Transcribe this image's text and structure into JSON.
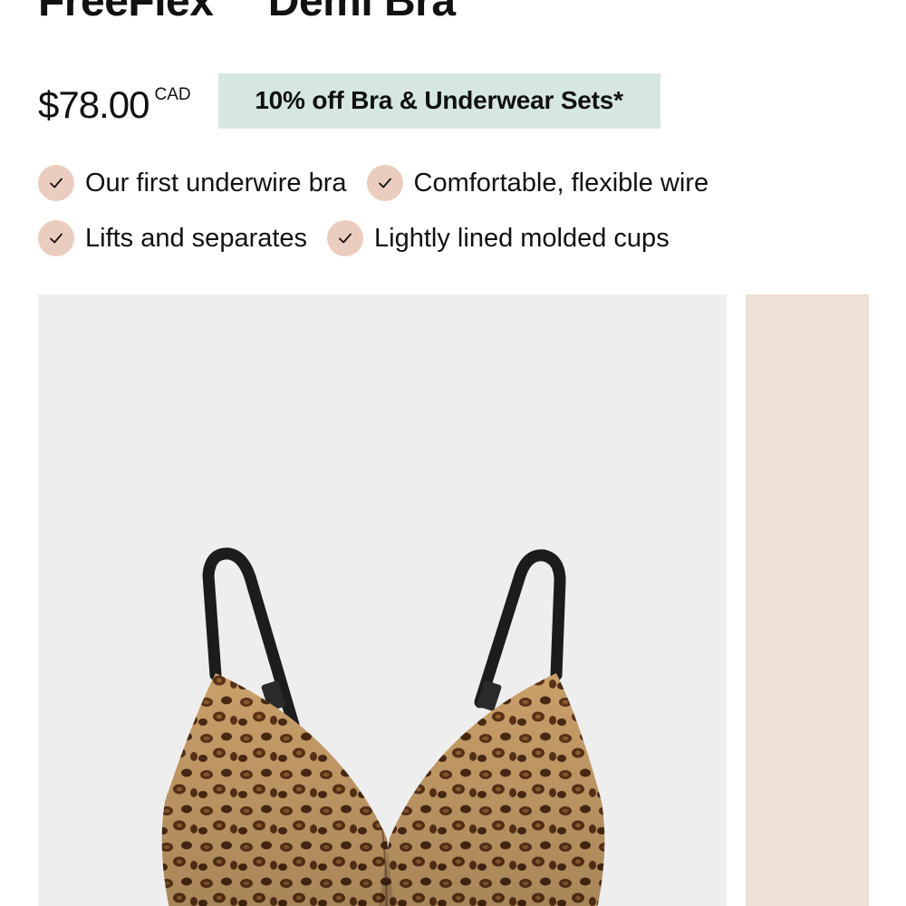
{
  "product": {
    "title": "FreeFlex™ Demi Bra",
    "price": "$78.00",
    "currency": "CAD",
    "promo_label": "10% off Bra & Underwear Sets*"
  },
  "features": [
    {
      "label": "Our first underwire bra",
      "icon": "check-icon"
    },
    {
      "label": "Comfortable, flexible wire",
      "icon": "check-icon"
    },
    {
      "label": "Lifts and separates",
      "icon": "check-icon"
    },
    {
      "label": "Lightly lined molded cups",
      "icon": "check-icon"
    }
  ],
  "gallery": {
    "main_image": "leopard-print-bra-image",
    "next_image": "next-product-image"
  },
  "colors": {
    "promo_bg": "#d6e7e0",
    "check_bg": "#ebcdbf",
    "image_bg": "#eeeeee",
    "next_image_bg": "#ede0d5"
  }
}
